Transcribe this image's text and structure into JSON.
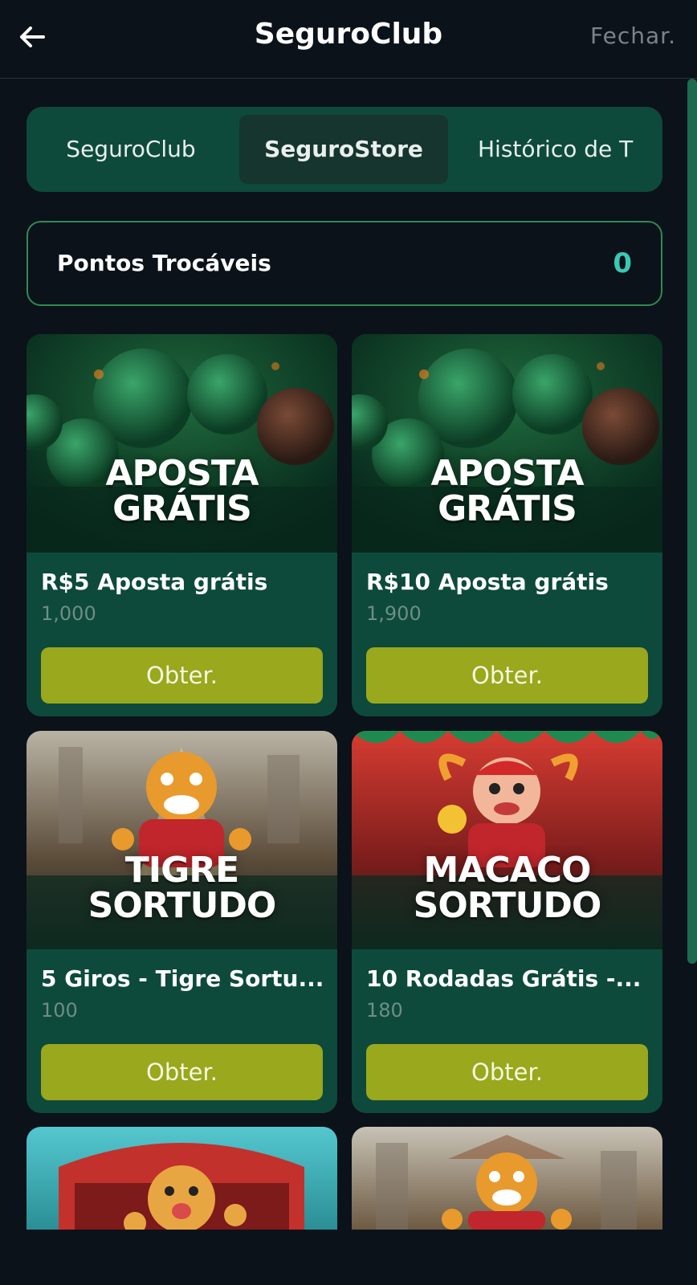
{
  "header": {
    "title": "SeguroClub",
    "close_label": "Fechar."
  },
  "tabs": [
    {
      "label": "SeguroClub",
      "active": false
    },
    {
      "label": "SeguroStore",
      "active": true
    },
    {
      "label": "Histórico de T",
      "active": false
    }
  ],
  "points": {
    "label": "Pontos Trocáveis",
    "value": "0"
  },
  "items": [
    {
      "image_text": [
        "APOSTA",
        "GRÁTIS"
      ],
      "title": "R$5 Aposta grátis",
      "cost": "1,000",
      "button": "Obter."
    },
    {
      "image_text": [
        "APOSTA",
        "GRÁTIS"
      ],
      "title": "R$10 Aposta grátis",
      "cost": "1,900",
      "button": "Obter."
    },
    {
      "image_text": [
        "TIGRE",
        "SORTUDO"
      ],
      "title": "5 Giros - Tigre Sortu...",
      "cost": "100",
      "button": "Obter."
    },
    {
      "image_text": [
        "MACACO",
        "SORTUDO"
      ],
      "title": "10 Rodadas Grátis -...",
      "cost": "180",
      "button": "Obter."
    }
  ],
  "colors": {
    "background": "#0b1219",
    "card": "#0d4a3c",
    "button": "#99a81c",
    "accent": "#39c9b4"
  }
}
